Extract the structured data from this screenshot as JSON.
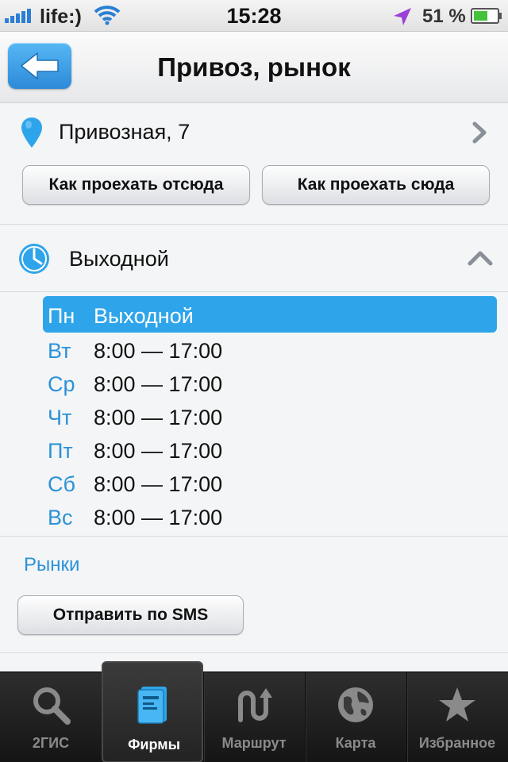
{
  "status_bar": {
    "carrier": "life:)",
    "time": "15:28",
    "battery": "51 %"
  },
  "nav": {
    "title": "Привоз, рынок"
  },
  "address": {
    "text": "Привозная, 7"
  },
  "route": {
    "from_label": "Как проехать отсюда",
    "to_label": "Как проехать сюда"
  },
  "hours": {
    "status": "Выходной",
    "schedule": [
      {
        "day": "Пн",
        "hours": "Выходной"
      },
      {
        "day": "Вт",
        "hours": "8:00 — 17:00"
      },
      {
        "day": "Ср",
        "hours": "8:00 — 17:00"
      },
      {
        "day": "Чт",
        "hours": "8:00 — 17:00"
      },
      {
        "day": "Пт",
        "hours": "8:00 — 17:00"
      },
      {
        "day": "Сб",
        "hours": "8:00 — 17:00"
      },
      {
        "day": "Вс",
        "hours": "8:00 — 17:00"
      }
    ]
  },
  "category": {
    "label": "Рынки"
  },
  "sms": {
    "label": "Отправить по SMS"
  },
  "tabs": [
    {
      "label": "2ГИС",
      "icon": "search-icon"
    },
    {
      "label": "Фирмы",
      "icon": "directory-icon"
    },
    {
      "label": "Маршрут",
      "icon": "route-icon"
    },
    {
      "label": "Карта",
      "icon": "globe-icon"
    },
    {
      "label": "Избранное",
      "icon": "star-icon"
    }
  ],
  "colors": {
    "accent": "#2ea5ea",
    "link": "#2b92d8"
  }
}
